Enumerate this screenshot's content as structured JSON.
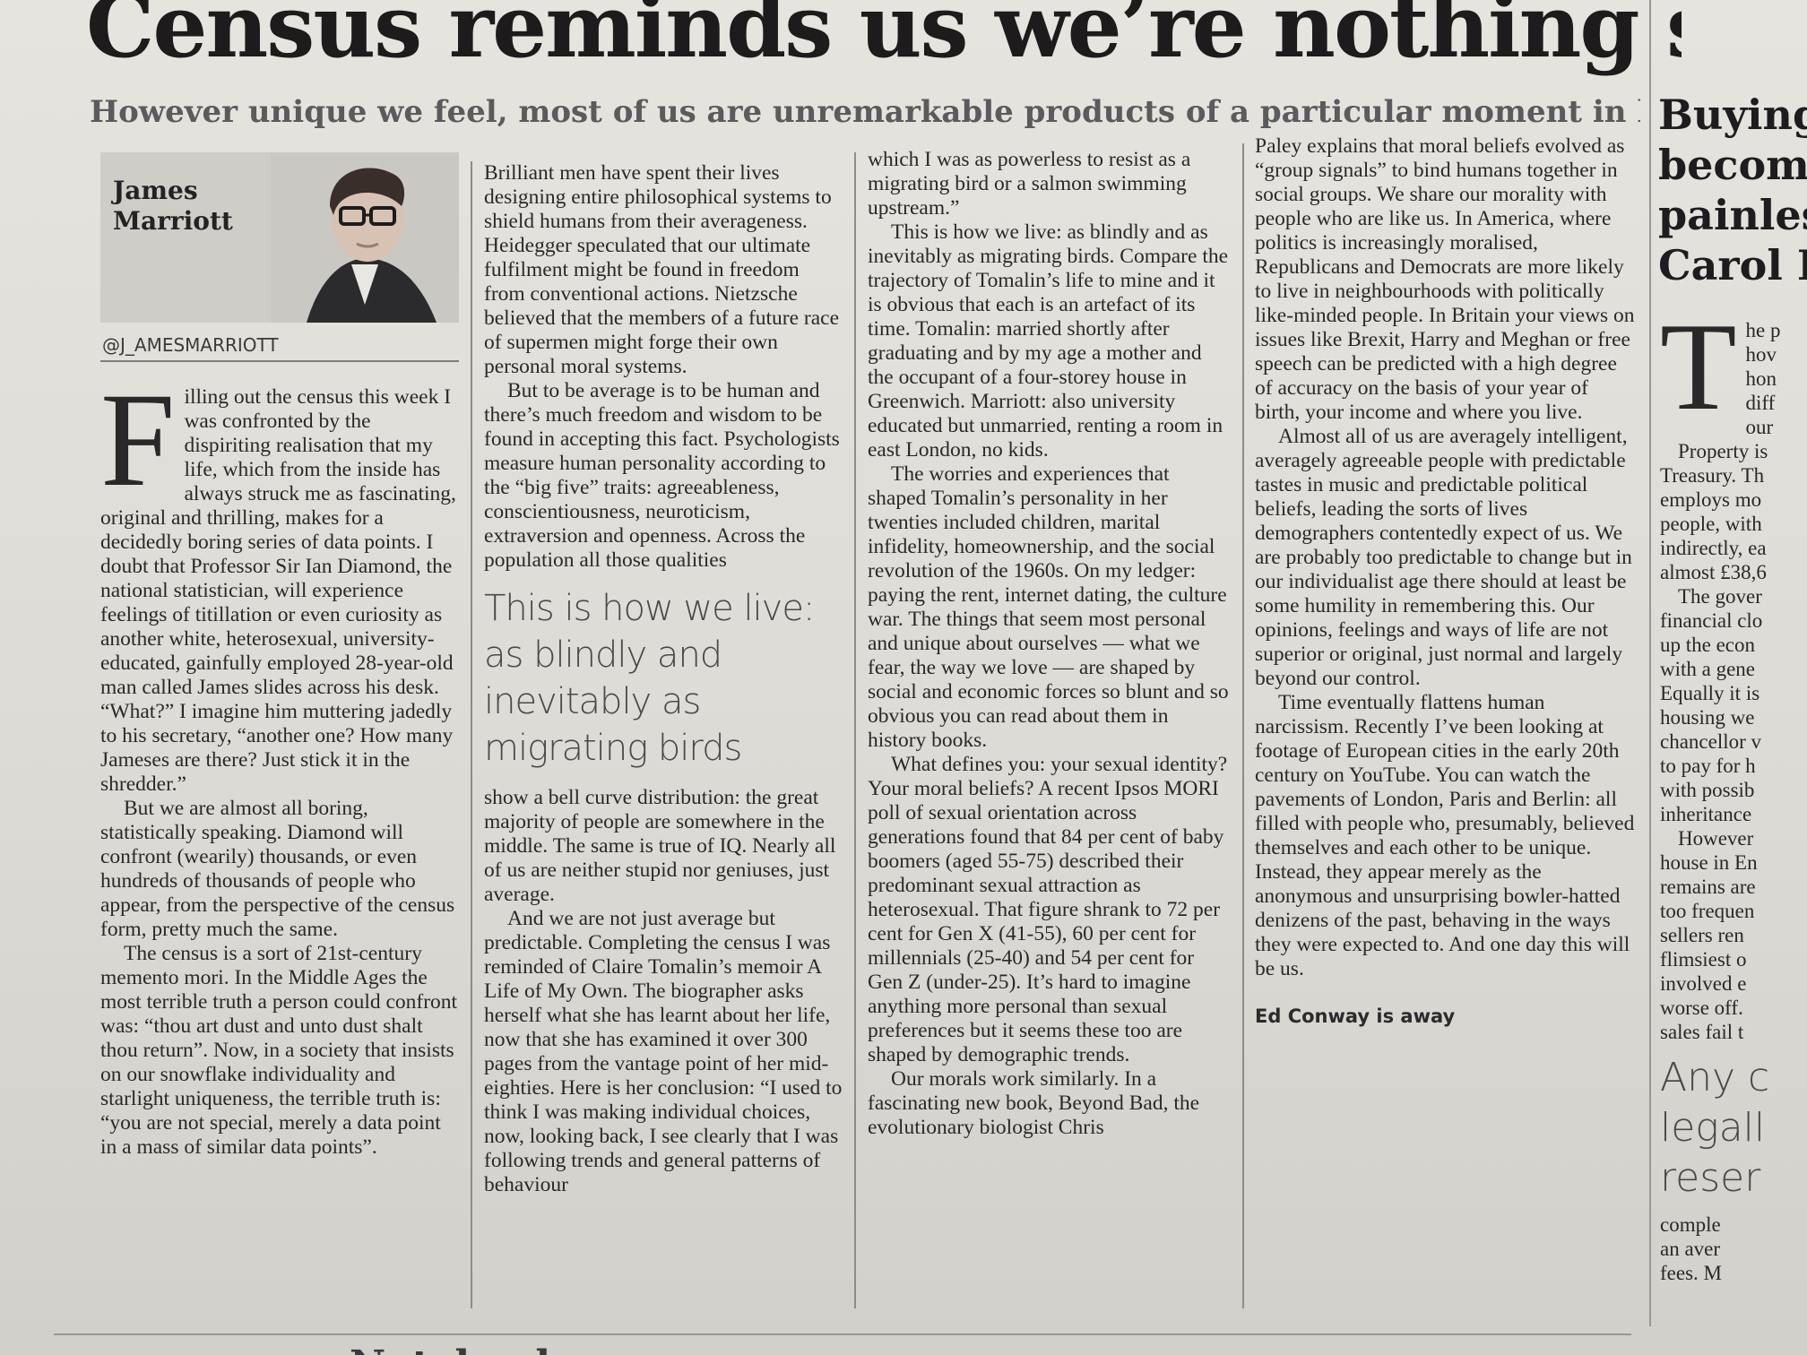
{
  "article": {
    "headline": "Census reminds us we’re nothing special",
    "standfirst": "However unique we feel, most of us are unremarkable products of a particular moment in history",
    "author": {
      "name": "James Marriott",
      "handle": "@J_AMESMARRIOTT"
    },
    "dropcap": "F",
    "col1": [
      "illing out the census this week I was confronted by the dispiriting realisation that my life, which from the inside has always struck me as fascinating, original and thrilling, makes for a decidedly boring series of data points. I doubt that Professor Sir Ian Diamond, the national statistician, will experience feelings of titillation or even curiosity as another white, heterosexual, university-educated, gainfully employed 28-year-old man called James slides across his desk. “What?” I imagine him muttering jadedly to his secretary, “another one? How many Jameses are there? Just stick it in the shredder.”",
      "But we are almost all boring, statistically speaking. Diamond will confront (wearily) thousands, or even hundreds of thousands of people who appear, from the perspective of the census form, pretty much the same.",
      "The census is a sort of 21st-century memento mori. In the Middle Ages the most terrible truth a person could confront was: “thou art dust and unto dust shalt thou return”. Now, in a society that insists on our snowflake individuality and starlight uniqueness, the terrible truth is: “you are not special, merely a data point in a mass of similar data points”."
    ],
    "col2a": [
      "Brilliant men have spent their lives designing entire philosophical systems to shield humans from their averageness. Heidegger speculated that our ultimate fulfilment might be found in freedom from conventional actions. Nietzsche believed that the members of a future race of supermen might forge their own personal moral systems.",
      "But to be average is to be human and there’s much freedom and wisdom to be found in accepting this fact. Psychologists measure human personality according to the “big five” traits: agreeableness, conscientiousness, neuroticism, extraversion and openness. Across the population all those qualities"
    ],
    "pullquote": "This is how we live: as blindly and inevitably as migrating birds",
    "col2b": [
      "show a bell curve distribution: the great majority of people are somewhere in the middle. The same is true of IQ. Nearly all of us are neither stupid nor geniuses, just average.",
      "And we are not just average but predictable. Completing the census I was reminded of Claire Tomalin’s memoir A Life of My Own. The biographer asks herself what she has learnt about her life, now that she has examined it over 300 pages from the vantage point of her mid-eighties. Here is her conclusion: “I used to think I was making individual choices, now, looking back, I see clearly that I was following trends and general patterns of behaviour"
    ],
    "col3": [
      "which I was as powerless to resist as a migrating bird or a salmon swimming upstream.”",
      "This is how we live: as blindly and as inevitably as migrating birds. Compare the trajectory of Tomalin’s life to mine and it is obvious that each is an artefact of its time. Tomalin: married shortly after graduating and by my age a mother and the occupant of a four-storey house in Greenwich. Marriott: also university educated but unmarried, renting a room in east London, no kids.",
      "The worries and experiences that shaped Tomalin’s personality in her twenties included children, marital infidelity, homeownership, and the social revolution of the 1960s. On my ledger: paying the rent, internet dating, the culture war. The things that seem most personal and unique about ourselves — what we fear, the way we love — are shaped by social and economic forces so blunt and so obvious you can read about them in history books.",
      "What defines you: your sexual identity? Your moral beliefs? A recent Ipsos MORI poll of sexual orientation across generations found that 84 per cent of baby boomers (aged 55-75) described their predominant sexual attraction as heterosexual. That figure shrank to 72 per cent for Gen X (41-55), 60 per cent for millennials (25-40) and 54 per cent for Gen Z (under-25). It’s hard to imagine anything more personal than sexual preferences but it seems these too are shaped by demographic trends.",
      "Our morals work similarly. In a fascinating new book, Beyond Bad, the evolutionary biologist Chris"
    ],
    "col4": [
      "Paley explains that moral beliefs evolved as “group signals” to bind humans together in social groups. We share our morality with people who are like us. In America, where politics is increasingly moralised, Republicans and Democrats are more likely to live in neighbourhoods with politically like-minded people. In Britain your views on issues like Brexit, Harry and Meghan or free speech can be predicted with a high degree of accuracy on the basis of your year of birth, your income and where you live.",
      "Almost all of us are averagely intelligent, averagely agreeable people with predictable tastes in music and predictable political beliefs, leading the sorts of lives demographers contentedly expect of us. We are probably too predictable to change but in our individualist age there should at least be some humility in remembering this. Our opinions, feelings and ways of life are not superior or original, just normal and largely beyond our control.",
      "Time eventually flattens human narcissism. Recently I’ve been looking at footage of European cities in the early 20th century on YouTube. You can watch the pavements of London, Paris and Berlin: all filled with people who, presumably, believed themselves and each other to be unique. Instead, they appear merely as the anonymous and unsurprising bowler-hatted denizens of the past, behaving in the ways they were expected to. And one day this will be us."
    ],
    "signoff": "Ed Conway is away"
  },
  "next_article": {
    "headline_lines": [
      "Buying",
      "become",
      "painles",
      "Carol L"
    ],
    "dropcap": "T",
    "lines_a": [
      "he p",
      "hov",
      "hon",
      "diff",
      "our"
    ],
    "lines_b": [
      "Property is",
      "Treasury. Th",
      "employs mo",
      "people, with",
      "indirectly, ea",
      "almost £38,6"
    ],
    "lines_c": [
      "The gover",
      "financial clo",
      "up the econ",
      "with a gene",
      "Equally it is",
      "housing we",
      "chancellor v",
      "to pay for h",
      "with possib",
      "inheritance"
    ],
    "lines_d": [
      "However",
      "house in En",
      "remains are",
      "too frequen",
      "sellers ren",
      "flimsiest o",
      "involved e",
      "worse off.",
      "sales fail t"
    ],
    "pull_lines": [
      "Any c",
      "legall",
      "reser"
    ],
    "lines_e": [
      "comple",
      "an aver",
      "fees. M"
    ]
  },
  "footer": {
    "section": "Notebook"
  }
}
